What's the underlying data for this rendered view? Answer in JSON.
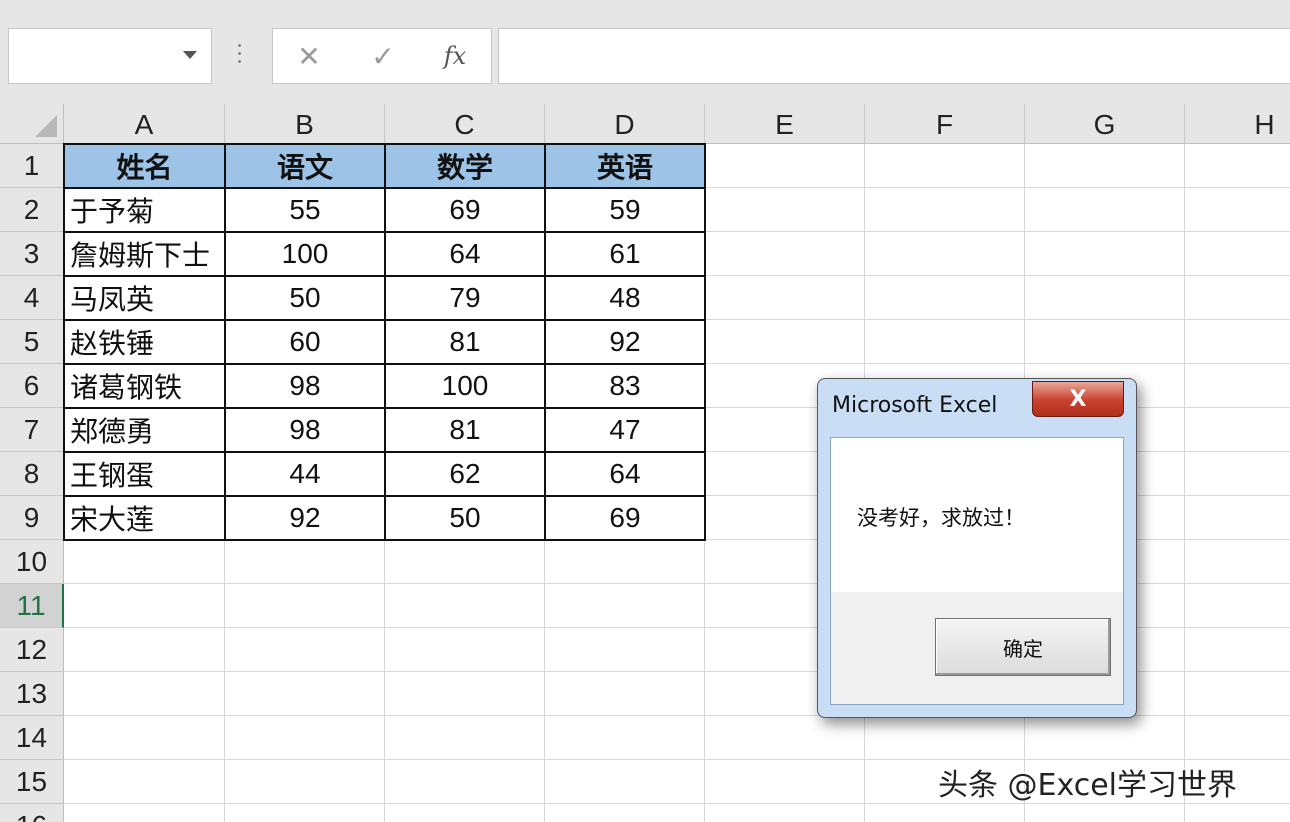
{
  "formula_bar": {
    "name_box_value": "",
    "cancel_icon": "✕",
    "enter_icon": "✓",
    "fx_label": "fx",
    "formula_value": ""
  },
  "columns": [
    "A",
    "B",
    "C",
    "D",
    "E",
    "F",
    "G",
    "H"
  ],
  "rows": [
    "1",
    "2",
    "3",
    "4",
    "5",
    "6",
    "7",
    "8",
    "9",
    "10",
    "11",
    "12",
    "13",
    "14",
    "15",
    "16"
  ],
  "active_row": "11",
  "table": {
    "header": [
      "姓名",
      "语文",
      "数学",
      "英语"
    ],
    "header_color": "#9dc3e6",
    "rows": [
      [
        "于予菊",
        "55",
        "69",
        "59"
      ],
      [
        "詹姆斯下士",
        "100",
        "64",
        "61"
      ],
      [
        "马凤英",
        "50",
        "79",
        "48"
      ],
      [
        "赵铁锤",
        "60",
        "81",
        "92"
      ],
      [
        "诸葛钢铁",
        "98",
        "100",
        "83"
      ],
      [
        "郑德勇",
        "98",
        "81",
        "47"
      ],
      [
        "王钢蛋",
        "44",
        "62",
        "64"
      ],
      [
        "宋大莲",
        "92",
        "50",
        "69"
      ]
    ]
  },
  "dialog": {
    "title": "Microsoft Excel",
    "close_label": "X",
    "message": "没考好，求放过！",
    "ok_label": "确定"
  },
  "watermark": "头条 @Excel学习世界"
}
